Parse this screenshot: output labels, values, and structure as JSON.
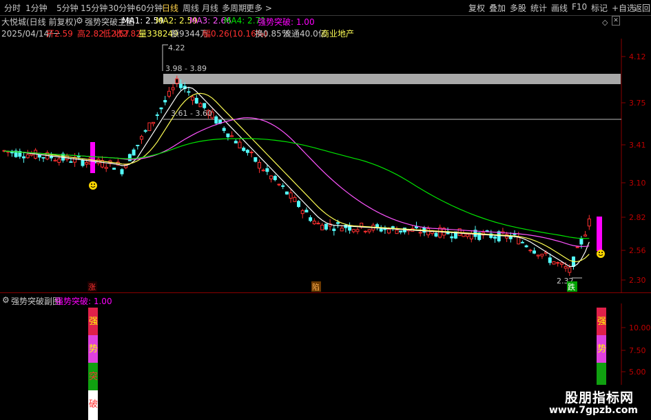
{
  "toolbar": {
    "left": [
      "分时",
      "1分钟",
      "5分钟",
      "15分钟",
      "30分钟",
      "60分钟",
      "日线",
      "周线",
      "月线",
      "多周期",
      "更多 >"
    ],
    "active": "日线",
    "right": [
      "复权",
      "叠加",
      "多股",
      "统计",
      "画线",
      "F10",
      "标记",
      "+自选",
      "返回"
    ]
  },
  "header": {
    "stock": "大悦城(日线 前复权)",
    "indicator_main": "强势突破主图",
    "ma1": "MA1: 2.59",
    "ma2": "MA2: 2.59",
    "ma3": "MA3: 2.66",
    "ma4": "MA4: 2.71",
    "signal": "强势突破: 1.00",
    "date": "2025/04/14/一",
    "open": "开2.59",
    "high": "高2.82",
    "low": "低2.57",
    "close": "收2.82",
    "volume": "量338249",
    "amount": "额9344万",
    "change": "幅0.26(10.16%)",
    "turnover": "换0.85%",
    "float": "流通40.0亿",
    "sector": "商业地产"
  },
  "sub_header": {
    "indicator": "强势突破副图",
    "signal": "强势突破: 1.00"
  },
  "annotations": {
    "peak": "4.22",
    "range_upper": "3.98 - 3.89",
    "range_lower": "3.61 - 3.60",
    "low": "2.32",
    "zhang": "涨",
    "xian": "陷",
    "die": "跌",
    "qiang": "强",
    "shi": "势",
    "tu": "突",
    "po": "破"
  },
  "price_axis": [
    "4.12",
    "3.75",
    "3.41",
    "3.10",
    "2.82",
    "2.56",
    "2.30"
  ],
  "sub_axis": [
    "10.00",
    "7.50",
    "5.00"
  ],
  "watermark": {
    "title": "股朋指标网",
    "url": "www.7gpzb.com"
  },
  "colors": {
    "up": "#ff3030",
    "down": "#54fcfc",
    "ma1": "#ffffff",
    "ma2": "#ffff54",
    "ma3": "#ff54ff",
    "ma4": "#00e600",
    "magenta": "#ff00ff"
  }
}
